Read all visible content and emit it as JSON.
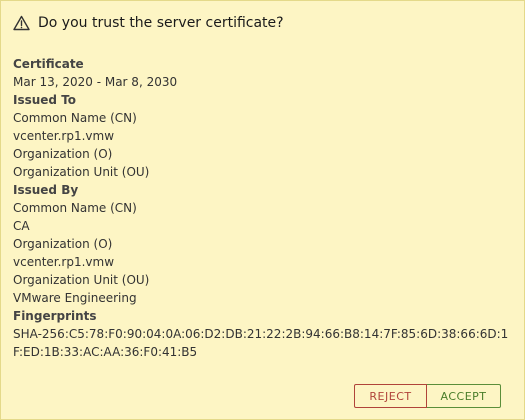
{
  "dialog": {
    "title": "Do you trust the server certificate?",
    "icon": "warning-triangle-icon"
  },
  "certificate": {
    "label": "Certificate",
    "validity": "Mar 13, 2020 - Mar 8, 2030"
  },
  "issued_to": {
    "label": "Issued To",
    "cn_label": "Common Name (CN)",
    "cn_value": "vcenter.rp1.vmw",
    "o_label": "Organization (O)",
    "ou_label": "Organization Unit (OU)"
  },
  "issued_by": {
    "label": "Issued By",
    "cn_label": "Common Name (CN)",
    "cn_value": "CA",
    "o_label": "Organization (O)",
    "o_value": "vcenter.rp1.vmw",
    "ou_label": "Organization Unit (OU)",
    "ou_value": "VMware Engineering"
  },
  "fingerprints": {
    "label": "Fingerprints",
    "sha256": "SHA-256:C5:78:F0:90:04:0A:06:D2:DB:21:22:2B:94:66:B8:14:7F:85:6D:38:66:6D:1F:ED:1B:33:AC:AA:36:F0:41:B5"
  },
  "buttons": {
    "reject": "REJECT",
    "accept": "ACCEPT"
  },
  "colors": {
    "background": "#fdf5c4",
    "reject": "#b0443a",
    "accept": "#4a7d2a"
  }
}
